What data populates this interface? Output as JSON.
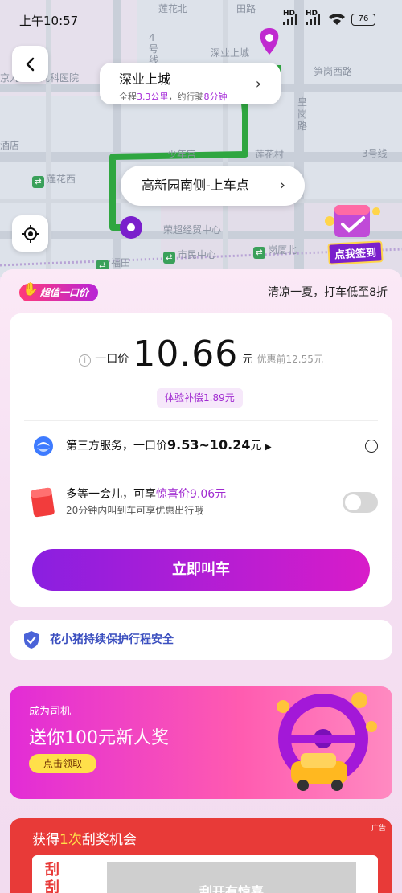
{
  "status_bar": {
    "time": "上午10:57",
    "hd1": "HD",
    "hd2": "HD",
    "battery": "76"
  },
  "map": {
    "labels": [
      "莲花北",
      "田路",
      "深业上城",
      "笋岗西路",
      "莲花村",
      "少年宫",
      "莲花西",
      "荣超经贸中心",
      "福田",
      "市民中心",
      "岗厦北",
      "皇岗路",
      "3号线",
      "4号线",
      "酒店",
      "京九",
      "儿科医院"
    ],
    "destination": {
      "name": "深业上城",
      "info_prefix": "全程",
      "distance": "3.3公里",
      "info_mid": "，约行驶",
      "duration": "8分钟"
    },
    "pickup": {
      "name": "高新园南侧-上车点"
    },
    "signin_label": "点我签到",
    "route_color": "#2fa640"
  },
  "panel": {
    "badge": "超值一口价",
    "promo": "清凉一夏，打车低至8折",
    "price": {
      "info_icon": "i",
      "label": "一口价",
      "value": "10.66",
      "unit": "元",
      "before": "优惠前12.55元"
    },
    "compensation": "体验补偿1.89元",
    "third_party": {
      "prefix": "第三方服务，一口价",
      "range": "9.53~10.24",
      "unit": "元"
    },
    "wait": {
      "prefix": "多等一会儿，可享",
      "highlight": "惊喜价9.06元",
      "sub": "20分钟内叫到车可享优惠出行哦"
    },
    "call_button": "立即叫车",
    "safety": "花小猪持续保护行程安全",
    "driver": {
      "line1": "成为司机",
      "line2": "送你100元新人奖",
      "button": "点击领取"
    },
    "lottery": {
      "prefix": "获得",
      "count": "1次",
      "suffix": "刮奖机会",
      "ad": "广告",
      "left": "刮刮",
      "cover": "刮开有惊喜"
    }
  }
}
